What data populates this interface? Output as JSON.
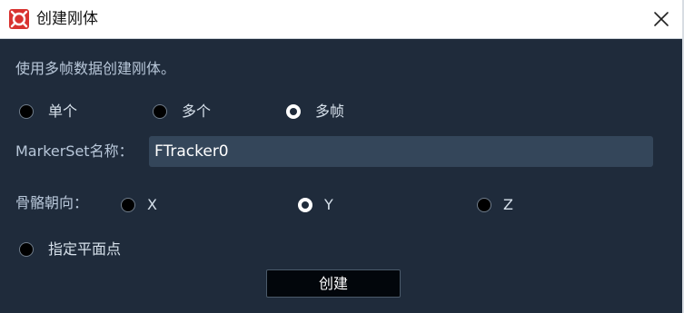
{
  "window": {
    "title": "创建刚体",
    "close_icon": "close-icon",
    "app_icon": "xingying-logo-icon"
  },
  "description": "使用多帧数据创建刚体。",
  "mode_options": [
    {
      "label": "单个",
      "checked": false
    },
    {
      "label": "多个",
      "checked": false
    },
    {
      "label": "多帧",
      "checked": true
    }
  ],
  "markerset": {
    "label": "MarkerSet名称：",
    "value": "FTracker0"
  },
  "bone_direction": {
    "label": "骨骼朝向：",
    "options": [
      {
        "label": "X",
        "checked": false
      },
      {
        "label": "Y",
        "checked": true
      },
      {
        "label": "Z",
        "checked": false
      }
    ]
  },
  "plane_point": {
    "label": "指定平面点",
    "checked": false
  },
  "create_button": "创建",
  "colors": {
    "background": "#1f2b3b",
    "input_bg": "#34465a",
    "logo_red": "#d8322f"
  }
}
